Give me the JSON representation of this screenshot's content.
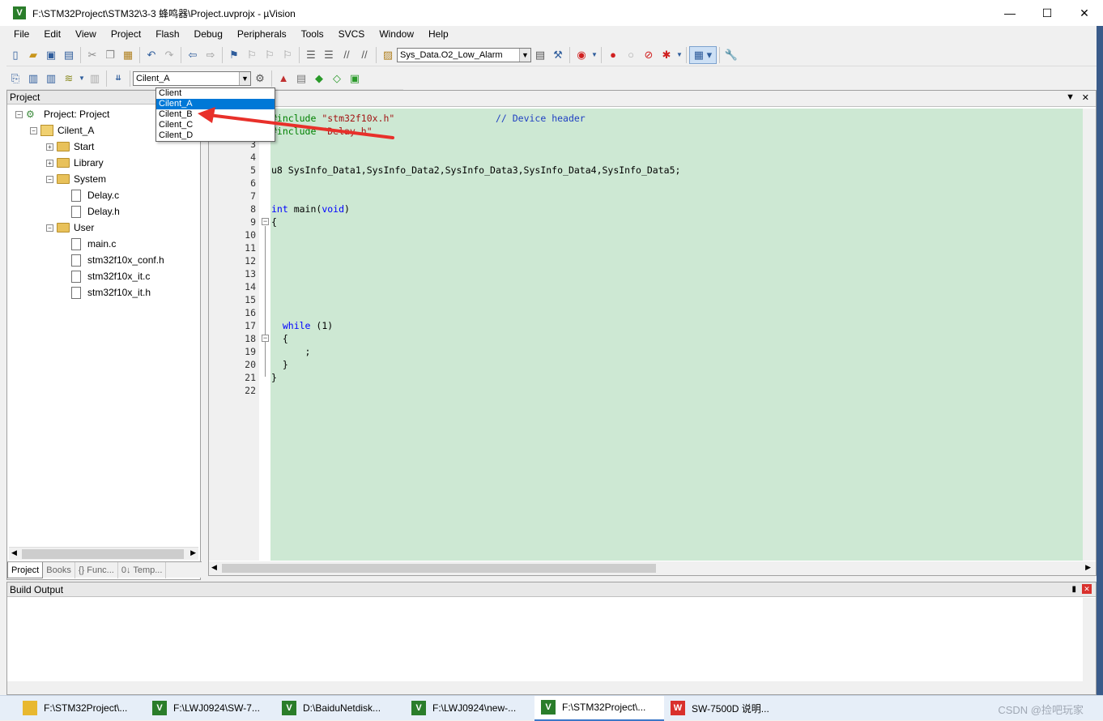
{
  "window": {
    "title": "F:\\STM32Project\\STM32\\3-3 蜂鸣器\\Project.uvprojx - µVision",
    "app_icon": "V",
    "minimize": "—",
    "maximize": "☐",
    "close": "✕"
  },
  "menu": [
    "File",
    "Edit",
    "View",
    "Project",
    "Flash",
    "Debug",
    "Peripherals",
    "Tools",
    "SVCS",
    "Window",
    "Help"
  ],
  "toolbar": {
    "find_combo": "Sys_Data.O2_Low_Alarm",
    "target_combo": "Cilent_A"
  },
  "target_dropdown": {
    "items": [
      "Client",
      "Cilent_A",
      "Cilent_B",
      "Cilent_C",
      "Cilent_D"
    ],
    "selected_index": 1
  },
  "project_panel": {
    "title": "Project",
    "tree": [
      {
        "label": "Project: Project",
        "level": 0,
        "type": "project"
      },
      {
        "label": "Cilent_A",
        "level": 1,
        "type": "target"
      },
      {
        "label": "Start",
        "level": 2,
        "type": "folder",
        "expand": "+"
      },
      {
        "label": "Library",
        "level": 2,
        "type": "folder",
        "expand": "+"
      },
      {
        "label": "System",
        "level": 2,
        "type": "folder",
        "expand": "−"
      },
      {
        "label": "Delay.c",
        "level": 3,
        "type": "file"
      },
      {
        "label": "Delay.h",
        "level": 3,
        "type": "file"
      },
      {
        "label": "User",
        "level": 2,
        "type": "folder",
        "expand": "−"
      },
      {
        "label": "main.c",
        "level": 3,
        "type": "file"
      },
      {
        "label": "stm32f10x_conf.h",
        "level": 3,
        "type": "file"
      },
      {
        "label": "stm32f10x_it.c",
        "level": 3,
        "type": "file"
      },
      {
        "label": "stm32f10x_it.h",
        "level": 3,
        "type": "file"
      }
    ],
    "tabs": [
      "Project",
      "Books",
      "{} Func...",
      "0↓ Temp..."
    ]
  },
  "editor": {
    "lines": [
      {
        "n": "1",
        "html": "<span class=\"pp\">#include </span><span class=\"str\">\"stm32f10x.h\"</span>                  <span class=\"cm\">// Device header</span>"
      },
      {
        "n": "2",
        "html": "<span class=\"pp\">#include </span><span class=\"str\">\"Delay.h\"</span>"
      },
      {
        "n": "3",
        "html": ""
      },
      {
        "n": "4",
        "html": ""
      },
      {
        "n": "5",
        "html": "u8 SysInfo_Data1,SysInfo_Data2,SysInfo_Data3,SysInfo_Data4,SysInfo_Data5;"
      },
      {
        "n": "6",
        "html": ""
      },
      {
        "n": "7",
        "html": ""
      },
      {
        "n": "8",
        "html": "<span class=\"kw\">int</span> main(<span class=\"kw\">void</span>)"
      },
      {
        "n": "9",
        "html": "{"
      },
      {
        "n": "10",
        "html": ""
      },
      {
        "n": "11",
        "html": ""
      },
      {
        "n": "12",
        "html": ""
      },
      {
        "n": "13",
        "html": ""
      },
      {
        "n": "14",
        "html": ""
      },
      {
        "n": "15",
        "html": ""
      },
      {
        "n": "16",
        "html": ""
      },
      {
        "n": "17",
        "html": "  <span class=\"kw\">while</span> (1)"
      },
      {
        "n": "18",
        "html": "  {"
      },
      {
        "n": "19",
        "html": "      ;"
      },
      {
        "n": "20",
        "html": "  }"
      },
      {
        "n": "21",
        "html": "}"
      },
      {
        "n": "22",
        "html": ""
      }
    ]
  },
  "build_output": {
    "title": "Build Output"
  },
  "taskbar": [
    {
      "label": "F:\\STM32Project\\...",
      "icon": "folder",
      "color": "#e8b830"
    },
    {
      "label": "F:\\LWJ0924\\SW-7...",
      "icon": "V",
      "color": "#2a7d2a"
    },
    {
      "label": "D:\\BaiduNetdisk...",
      "icon": "V",
      "color": "#2a7d2a"
    },
    {
      "label": "F:\\LWJ0924\\new-...",
      "icon": "V",
      "color": "#2a7d2a"
    },
    {
      "label": "F:\\STM32Project\\...",
      "icon": "V",
      "color": "#2a7d2a",
      "active": true
    },
    {
      "label": "SW-7500D  说明...",
      "icon": "W",
      "color": "#d9302c"
    }
  ],
  "watermark": "CSDN @捡吧玩家"
}
